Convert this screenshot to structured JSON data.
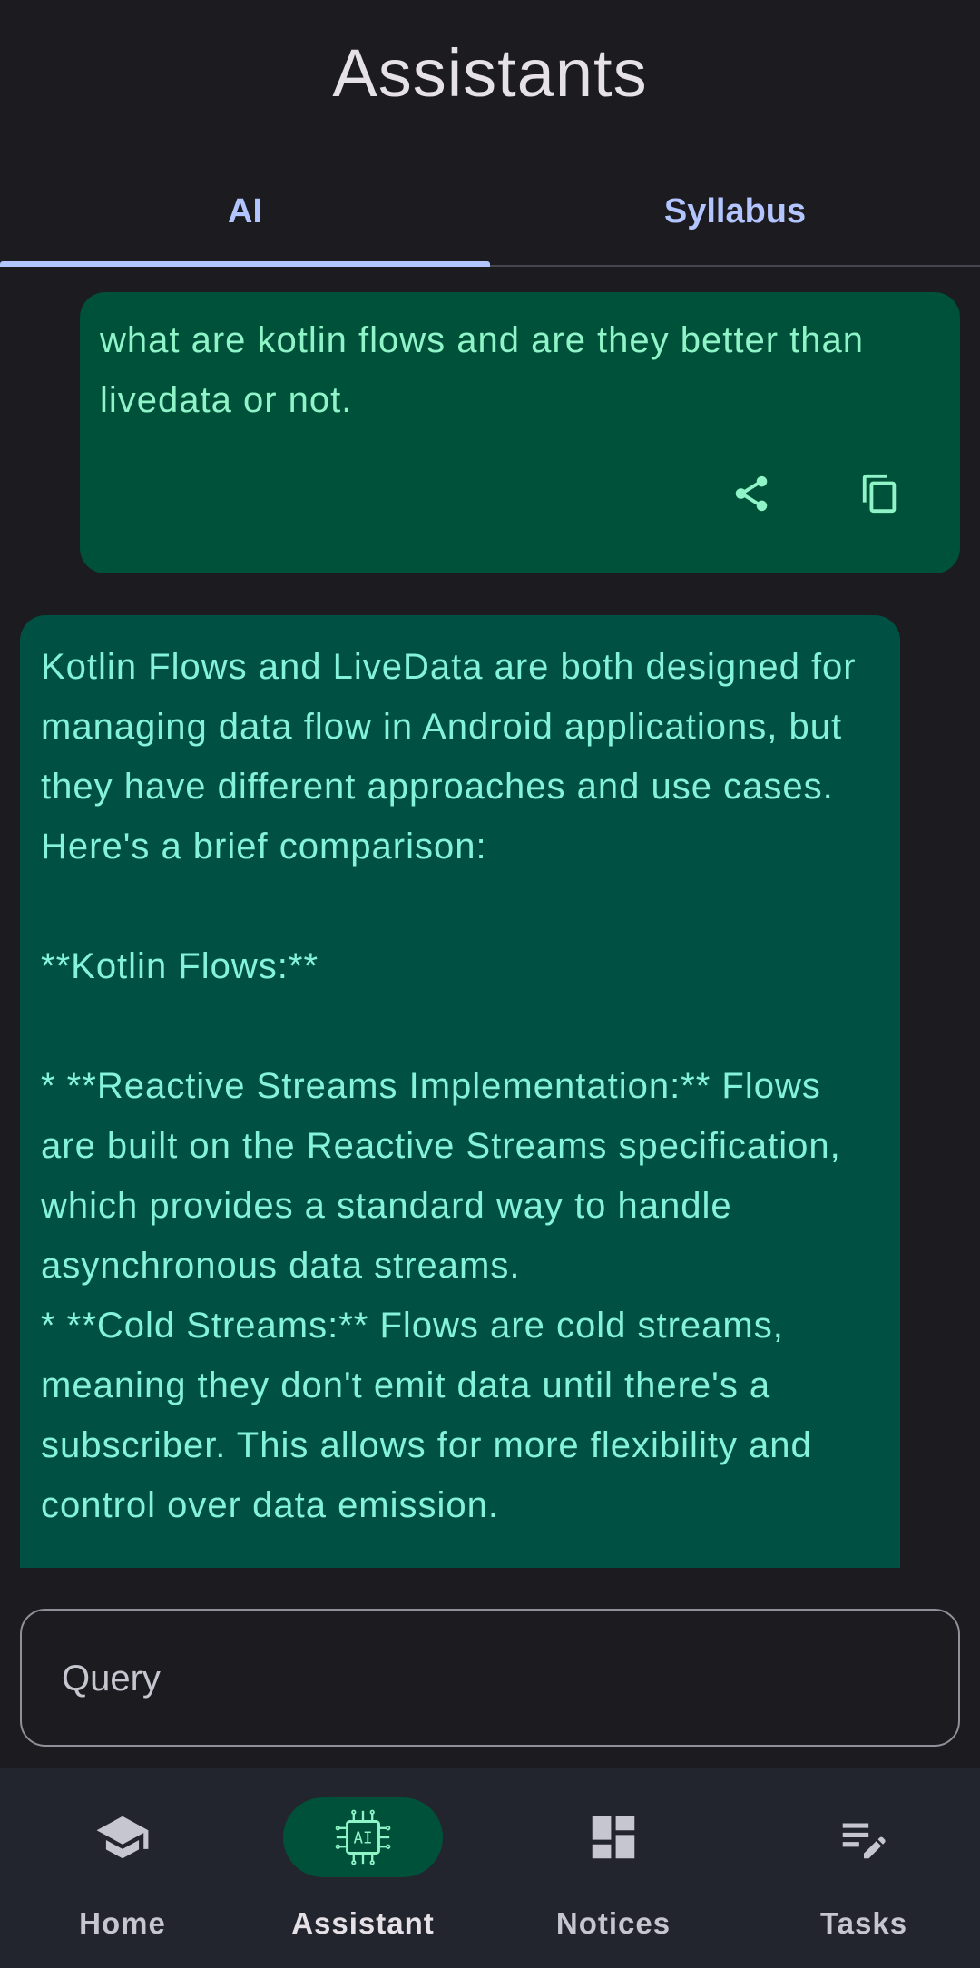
{
  "header": {
    "title": "Assistants"
  },
  "tabs": [
    {
      "label": "AI",
      "selected": true
    },
    {
      "label": "Syllabus",
      "selected": false
    }
  ],
  "messages": [
    {
      "role": "user",
      "text": "what are kotlin flows and are they better than livedata or not.",
      "actions": [
        "share-icon",
        "copy-icon"
      ]
    },
    {
      "role": "assistant",
      "text": "Kotlin Flows and LiveData are both designed for managing data flow in Android applications, but they have different approaches and use cases. Here's a brief comparison:\n\n**Kotlin Flows:**\n\n* **Reactive Streams Implementation:** Flows are built on the Reactive Streams specification, which provides a standard way to handle asynchronous data streams.\n* **Cold Streams:** Flows are cold streams, meaning they don't emit data until there's a subscriber. This allows for more flexibility and control over data emission."
    }
  ],
  "input": {
    "placeholder": "Query",
    "value": ""
  },
  "bottom_nav": [
    {
      "label": "Home",
      "icon": "school-icon",
      "active": false
    },
    {
      "label": "Assistant",
      "icon": "ai-chip-icon",
      "active": true
    },
    {
      "label": "Notices",
      "icon": "dashboard-icon",
      "active": false
    },
    {
      "label": "Tasks",
      "icon": "edit-note-icon",
      "active": false
    }
  ],
  "colors": {
    "background": "#1b1b20",
    "accent": "#b3c5ff",
    "user_bubble": "#005139",
    "assistant_bubble": "#005143",
    "bubble_text": "#85f3d9",
    "nav_background": "#23252e"
  }
}
